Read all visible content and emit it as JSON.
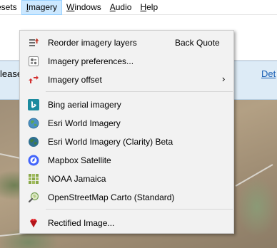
{
  "menubar": {
    "items": [
      {
        "label": "esets",
        "mnemonic": ""
      },
      {
        "label": "Imagery",
        "mnemonic": "I"
      },
      {
        "label": "Windows",
        "mnemonic": "W"
      },
      {
        "label": "Audio",
        "mnemonic": "A"
      },
      {
        "label": "Help",
        "mnemonic": "H"
      }
    ],
    "active": "Imagery"
  },
  "notice": {
    "left_text": "lease",
    "right_link": "Det"
  },
  "imagery_menu": {
    "items": [
      {
        "label": "Reorder imagery layers",
        "shortcut": "Back Quote",
        "icon": "layers-reorder-icon"
      },
      {
        "label": "Imagery preferences...",
        "icon": "preferences-icon"
      },
      {
        "label": "Imagery offset",
        "submenu": "›",
        "icon": "offset-arrows-icon"
      },
      {
        "label": "Bing aerial imagery",
        "icon": "bing-logo-icon"
      },
      {
        "label": "Esri World Imagery",
        "icon": "globe-icon"
      },
      {
        "label": "Esri World Imagery (Clarity) Beta",
        "icon": "globe-dark-icon"
      },
      {
        "label": "Mapbox Satellite",
        "icon": "mapbox-logo-icon"
      },
      {
        "label": "NOAA Jamaica",
        "icon": "grid-tiles-icon"
      },
      {
        "label": "OpenStreetMap Carto (Standard)",
        "icon": "osm-magnifier-icon"
      },
      {
        "label": "Rectified Image...",
        "icon": "red-gem-icon"
      }
    ]
  },
  "colors": {
    "menu_bg": "#f2f2f2",
    "active_menu_bg": "#cce8ff",
    "notice_bg": "#ddebf6",
    "link": "#1a5fb4"
  }
}
